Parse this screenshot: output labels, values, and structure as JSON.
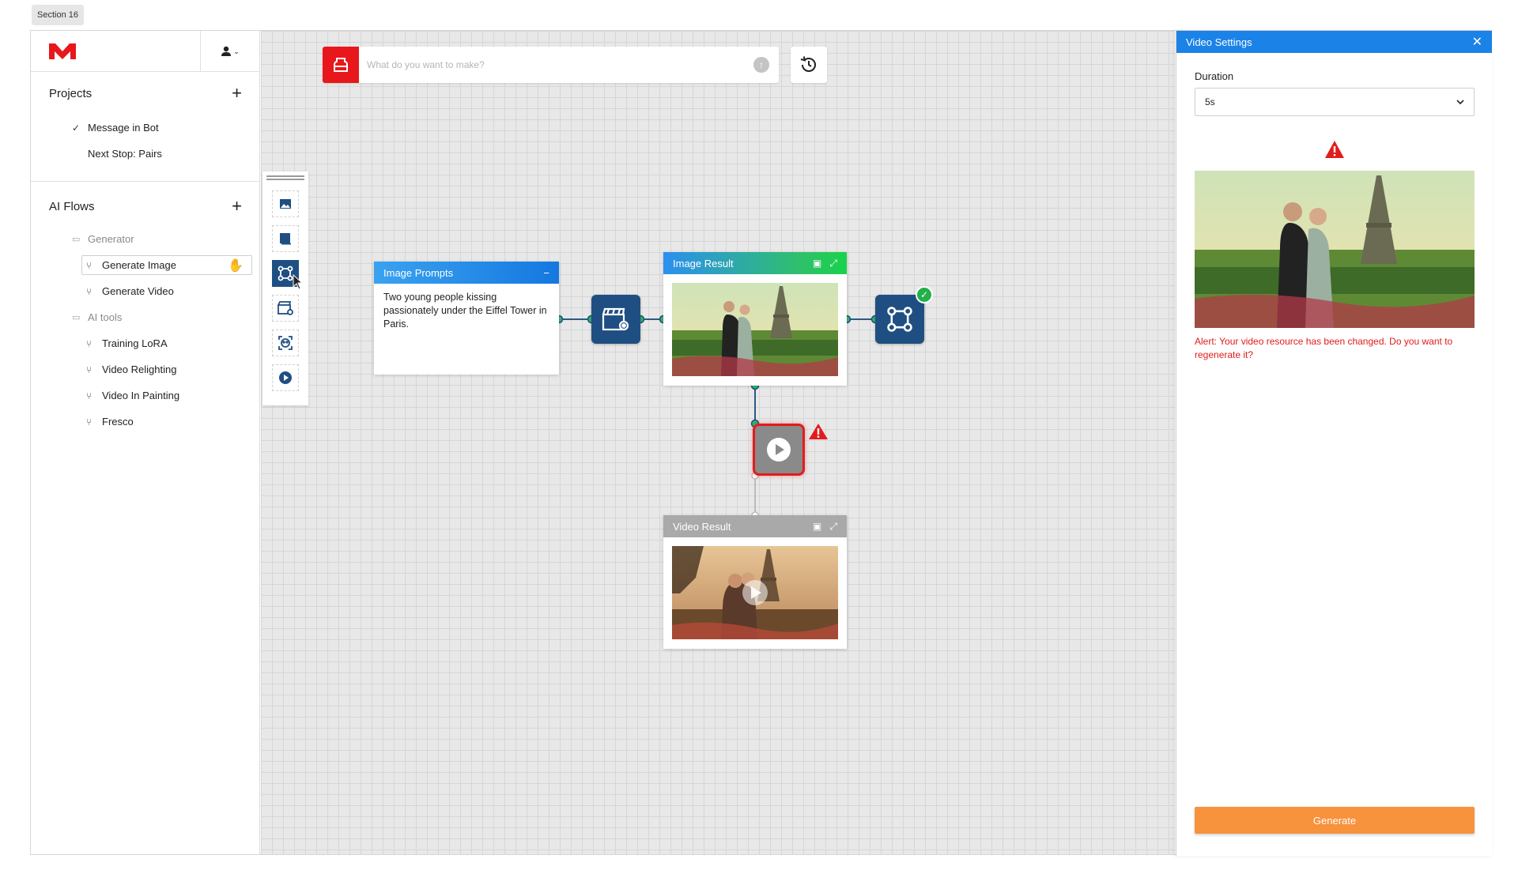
{
  "section_tag": "Section 16",
  "brand": {
    "logo_icon": "m-logo-icon",
    "accent": "#e8171c"
  },
  "sidebar": {
    "projects": {
      "title": "Projects",
      "items": [
        {
          "label": "Message in Bot",
          "checked": true
        },
        {
          "label": "Next Stop: Pairs",
          "checked": false
        }
      ]
    },
    "ai_flows": {
      "title": "AI Flows",
      "groups": [
        {
          "folder": "Generator",
          "items": [
            "Generate Image",
            "Generate Video"
          ]
        },
        {
          "folder": "AI tools",
          "items": [
            "Training LoRA",
            "Video Relighting",
            "Video In Painting",
            "Fresco"
          ]
        }
      ]
    }
  },
  "canvas": {
    "prompt_bar": {
      "placeholder": "What do you want to make?"
    },
    "palette_tools": [
      "image-tool-icon",
      "frame-tool-icon",
      "flow-tool-icon",
      "video-settings-tool-icon",
      "face-tool-icon",
      "play-tool-icon"
    ],
    "nodes": {
      "image_prompts": {
        "title": "Image Prompts",
        "collapse": "−",
        "text": "Two young people kissing passionately under the Eiffel Tower in Paris."
      },
      "image_result": {
        "title": "Image Result"
      },
      "video_result": {
        "title": "Video Result"
      }
    }
  },
  "panel": {
    "title": "Video Settings",
    "close": "✕",
    "duration_label": "Duration",
    "duration_value": "5s",
    "alert": "Alert: Your video resource has been changed. Do you want to regenerate it?",
    "generate_label": "Generate",
    "colors": {
      "header": "#1b82e8",
      "alert": "#e01b1b",
      "button": "#f7923d"
    }
  }
}
